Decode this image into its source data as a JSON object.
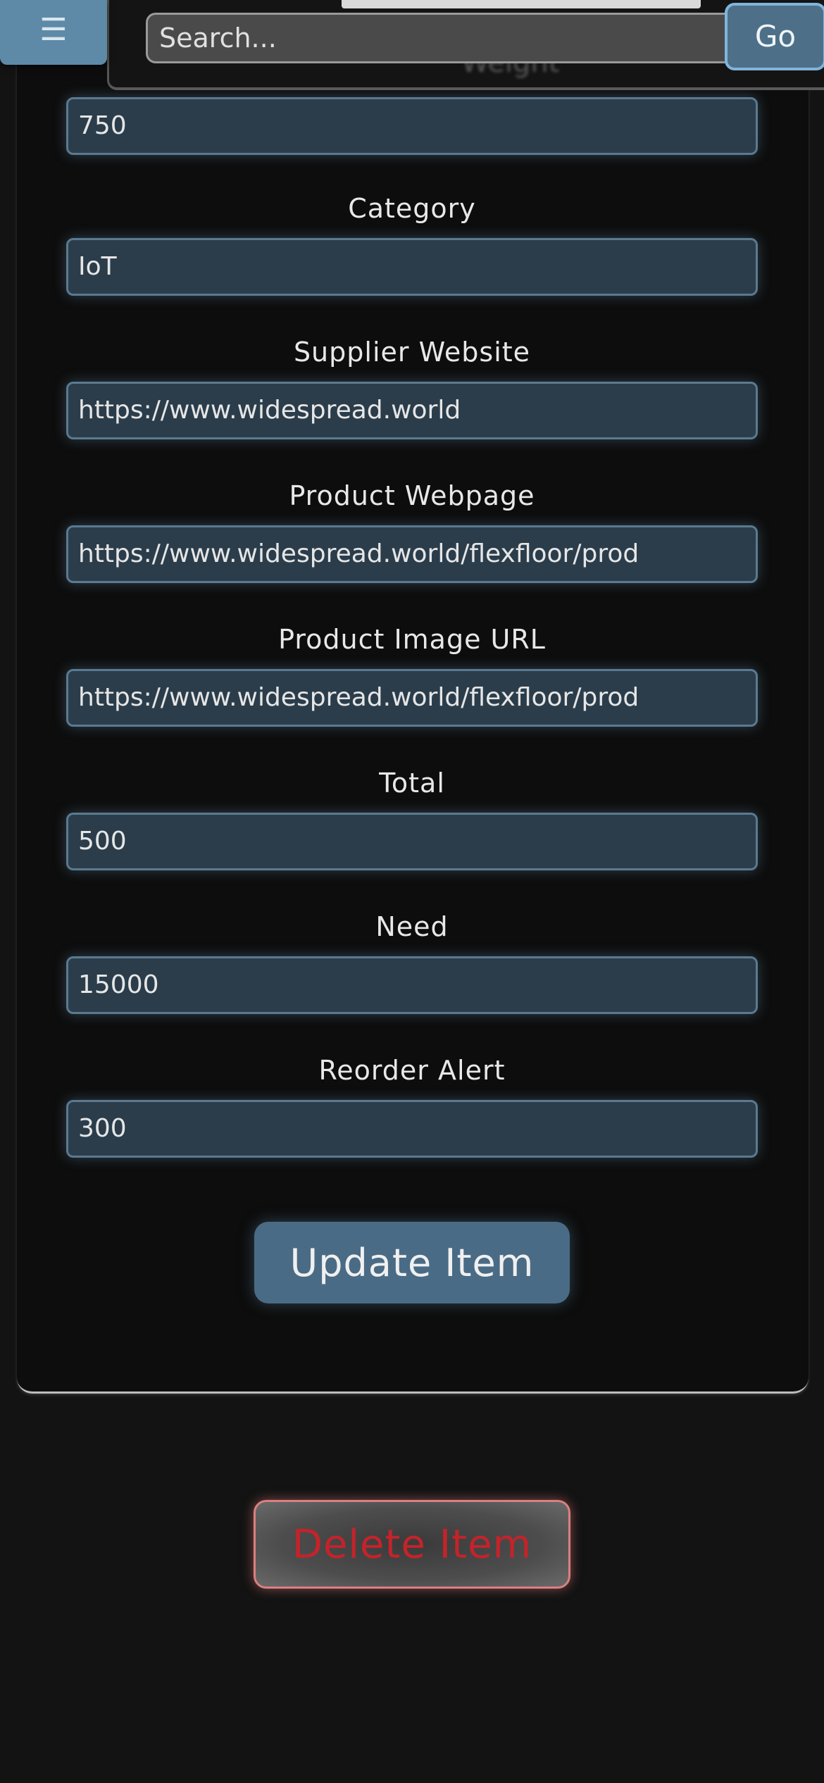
{
  "header": {
    "menu_icon": "☰",
    "search_placeholder": "Search...",
    "go_label": "Go"
  },
  "form": {
    "weight_label_partial": "Weight",
    "fields": [
      {
        "label": "",
        "value": "750"
      },
      {
        "label": "Category",
        "value": "IoT"
      },
      {
        "label": "Supplier Website",
        "value": "https://www.widespread.world"
      },
      {
        "label": "Product Webpage",
        "value": "https://www.widespread.world/flexfloor/prod"
      },
      {
        "label": "Product Image URL",
        "value": "https://www.widespread.world/flexfloor/prod"
      },
      {
        "label": "Total",
        "value": "500"
      },
      {
        "label": "Need",
        "value": "15000"
      },
      {
        "label": "Reorder Alert",
        "value": "300"
      }
    ],
    "update_label": "Update Item"
  },
  "actions": {
    "delete_label": "Delete Item"
  },
  "colors": {
    "background": "#131313",
    "input_bg": "#2b3d4b",
    "accent": "#4a6b85",
    "delete_text": "#c4232a"
  }
}
